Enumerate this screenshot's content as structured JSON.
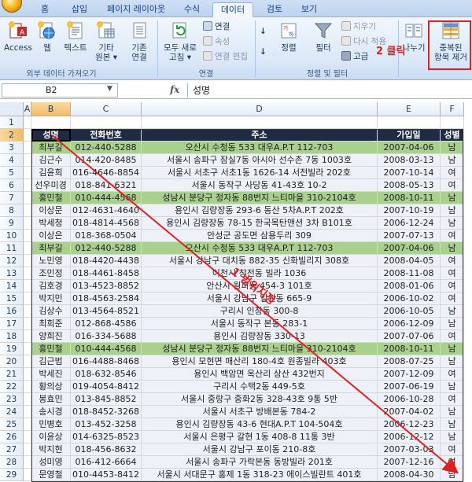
{
  "ribbon": {
    "tabs": [
      "홈",
      "삽입",
      "페이지 레이아웃",
      "수식",
      "데이터",
      "검토",
      "보기"
    ],
    "active_tab": "데이터",
    "groups": {
      "external": {
        "title": "외부 데이터 가져오기",
        "access": "Access",
        "web": "웹",
        "text": "텍스트",
        "other_l1": "기타",
        "other_l2": "원본 ▾",
        "existing_l1": "기존",
        "existing_l2": "연결"
      },
      "connections": {
        "title": "연결",
        "refresh_l1": "모두 새로",
        "refresh_l2": "고침 ▾",
        "connections": "연결",
        "properties": "속성",
        "edit_links": "연결 편집"
      },
      "sortfilter": {
        "title": "정렬 및 필터",
        "sort": "정렬",
        "filter": "필터",
        "clear": "지우기",
        "reapply": "다시 적용",
        "advanced": "고급"
      },
      "datatools": {
        "split_label": "나누기",
        "remove_dup_l1": "중복된",
        "remove_dup_l2": "항목 제거"
      }
    },
    "callout_step2": "2 클릭"
  },
  "formula_bar": {
    "name_box": "B2",
    "fx": "fx",
    "value": "성명"
  },
  "grid": {
    "columns": [
      "A",
      "B",
      "C",
      "D",
      "E",
      "F"
    ],
    "row_numbers": [
      "1",
      "2",
      "3",
      "4",
      "5",
      "6",
      "7",
      "8",
      "9",
      "10",
      "11",
      "12",
      "13",
      "14",
      "15",
      "16",
      "17",
      "18",
      "19",
      "20",
      "21",
      "22",
      "23",
      "24",
      "25",
      "26",
      "27",
      "28",
      "29"
    ],
    "header": [
      "성명",
      "전화번호",
      "주소",
      "가입일",
      "성별"
    ],
    "rows": [
      [
        "최부길",
        "012-440-5288",
        "오산시 수청동 533 대우A.P.T 112-703",
        "2007-04-06",
        "남",
        true
      ],
      [
        "김근수",
        "014-420-8485",
        "서울시 송파구 잠실7동 아시아 선수촌 7동 1003호",
        "2008-03-13",
        "남",
        false
      ],
      [
        "김윤희",
        "016-4646-8854",
        "서울시 서초구 서초1동 1626-14 서전빌라 202호",
        "2007-10-14",
        "여",
        false
      ],
      [
        "선우미경",
        "018-841-6321",
        "서울시 동작구 사당동 41-43호 10-2",
        "2008-05-13",
        "여",
        false
      ],
      [
        "홍민철",
        "010-444-4568",
        "성남시 분당구 정자동 88번지 느티마을 310-2104호",
        "2008-10-11",
        "남",
        true
      ],
      [
        "이상문",
        "012-4631-4640",
        "용인시 김량장동 293-6 동산 5차A.P.T 202호",
        "2007-10-19",
        "남",
        false
      ],
      [
        "박세청",
        "018-4814-4568",
        "용인시 김량장동 78-15 한국목탄맨션 3차 B101호",
        "2006-12-24",
        "남",
        false
      ],
      [
        "이상은",
        "018-368-0504",
        "안성군 공도면 삼용두리 309",
        "2007-07-13",
        "여",
        false
      ],
      [
        "최부길",
        "012-440-5288",
        "오산시 수청동 533 대우A.P.T 112-703",
        "2007-04-06",
        "남",
        true
      ],
      [
        "노민영",
        "018-4420-4438",
        "서울시 강남구 대치동 882-35 신화빌리지 308호",
        "2008-04-05",
        "여",
        false
      ],
      [
        "조민정",
        "018-4461-8458",
        "이천시 창전동 빌라 1036",
        "2008-11-08",
        "여",
        false
      ],
      [
        "김호경",
        "013-4523-8852",
        "안산시 월피동 454-3 101호",
        "2008-01-06",
        "여",
        false
      ],
      [
        "박지민",
        "018-4563-2584",
        "서울시 강남구 일원동 665-9",
        "2006-10-02",
        "여",
        false
      ],
      [
        "김상수",
        "013-4564-8521",
        "구리시 인창동 300-8",
        "2006-10-05",
        "남",
        false
      ],
      [
        "최희준",
        "012-868-4586",
        "서울시 동작구 본동 283-1",
        "2006-12-09",
        "남",
        false
      ],
      [
        "양희진",
        "016-334-5688",
        "용인시 김량장동 330-13",
        "2007-07-06",
        "여",
        false
      ],
      [
        "홍민철",
        "010-444-4568",
        "성남시 분당구 정자동 88번지 느티마을 310-2104호",
        "2008-10-11",
        "남",
        true
      ],
      [
        "김근범",
        "016-4488-8468",
        "용인시 모현면 매산리 180-4호 원종빌라 403호",
        "2008-07-25",
        "남",
        false
      ],
      [
        "박세진",
        "018-632-8546",
        "용인시 백암면 옥산리 상산 432번지",
        "2007-12-09",
        "여",
        false
      ],
      [
        "황의상",
        "019-4054-8412",
        "구리시 수택2동 449-5호",
        "2007-06-19",
        "남",
        false
      ],
      [
        "봉효민",
        "013-845-8852",
        "서울시 중랑구 중화2동 328-43호 9통 5반",
        "2006-10-28",
        "여",
        false
      ],
      [
        "송시경",
        "018-8452-3268",
        "서울시 서초구 방배본동 784-2",
        "2007-04-02",
        "남",
        false
      ],
      [
        "민병호",
        "013-452-3258",
        "용인시 김량장동 43-6 현대A.P.T 104-504호",
        "2006-12-23",
        "남",
        false
      ],
      [
        "이윤상",
        "014-6325-8523",
        "서울시 은평구 갈현 1동 408-8 11통 3반",
        "2006-12-12",
        "남",
        false
      ],
      [
        "박지현",
        "018-456-8632",
        "서울시 강남구 포이동 210-8호",
        "2007-03-03",
        "여",
        false
      ],
      [
        "성미영",
        "016-412-6664",
        "서울시 송파구 가락본동 동방빌라 201호",
        "2007-12-16",
        "여",
        false
      ],
      [
        "문영철",
        "010-4453-8412",
        "서울시 서대문구 홍제 1동 318-23 에이스빌란트 401호",
        "2008-04-30",
        "남",
        false
      ]
    ],
    "range_label": "1 범위지정"
  },
  "colors": {
    "accent_red": "#e02020",
    "header_fill": "#1f2a44",
    "duplicate_fill": "#a9d08e",
    "row_fill": "#eef1f7"
  }
}
